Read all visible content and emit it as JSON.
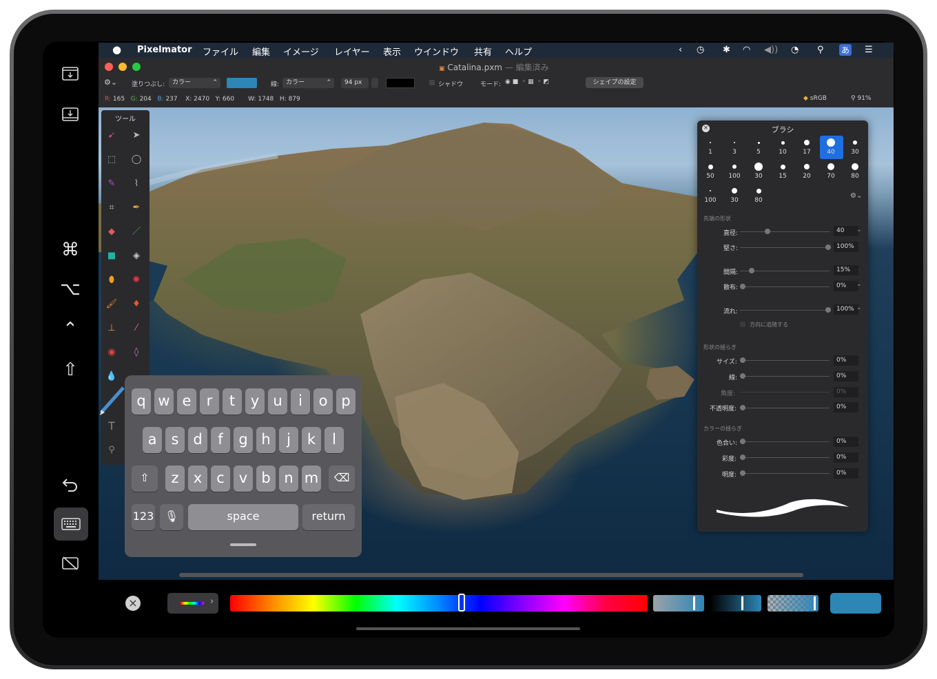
{
  "menubar": {
    "app": "Pixelmator",
    "items": [
      "ファイル",
      "編集",
      "イメージ",
      "レイヤー",
      "表示",
      "ウインドウ",
      "共有",
      "ヘルプ"
    ],
    "ime": "あ"
  },
  "window": {
    "title": "Catalina.pxm",
    "status": "編集済み"
  },
  "toolbar": {
    "fill_label": "塗りつぶし:",
    "fill_value": "カラー",
    "fill_color": "#2d86b6",
    "stroke_label": "線:",
    "stroke_value": "カラー",
    "stroke_width": "94 px",
    "stroke_color": "#000000",
    "shadow_label": "シャドウ",
    "mode_label": "モード:",
    "shape_settings_button": "シェイプの設定"
  },
  "infobar": {
    "r_label": "R:",
    "r": "165",
    "g_label": "G:",
    "g": "204",
    "b_label": "B:",
    "b": "237",
    "x_label": "X:",
    "x": "2470",
    "y_label": "Y:",
    "y": "660",
    "w_label": "W:",
    "w": "1748",
    "h_label": "H:",
    "h": "879",
    "color_profile": "sRGB",
    "zoom": "91%"
  },
  "tools_panel": {
    "title": "ツール"
  },
  "brushes_panel": {
    "title": "ブラシ",
    "presets_row1": [
      "1",
      "3",
      "5",
      "10",
      "17",
      "40",
      "30"
    ],
    "presets_row2": [
      "50",
      "100",
      "30",
      "15",
      "20",
      "70",
      "80"
    ],
    "presets_row3": [
      "100",
      "30",
      "80"
    ],
    "selected_preset": "40",
    "tip_section": "先端の形状",
    "diameter_label": "直径:",
    "diameter": "40",
    "hardness_label": "堅さ:",
    "hardness": "100%",
    "spacing_label": "間隔:",
    "spacing": "15%",
    "scatter_label": "散布:",
    "scatter": "0%",
    "flow_label": "流れ:",
    "flow": "100%",
    "follow_direction": "方向に追随する",
    "shape_jitter_section": "形状の揺らぎ",
    "size_label": "サイズ:",
    "size": "0%",
    "thin_label": "線:",
    "thin": "0%",
    "angle_label": "角度:",
    "angle": "0%",
    "opacity_label": "不透明度:",
    "opacity": "0%",
    "color_jitter_section": "カラーの揺らぎ",
    "hue_label": "色合い:",
    "hue": "0%",
    "saturation_label": "彩度:",
    "saturation": "0%",
    "brightness_label": "明度:",
    "brightness": "0%"
  },
  "keyboard": {
    "row1": [
      "q",
      "w",
      "e",
      "r",
      "t",
      "y",
      "u",
      "i",
      "o",
      "p"
    ],
    "row2": [
      "a",
      "s",
      "d",
      "f",
      "g",
      "h",
      "j",
      "k",
      "l"
    ],
    "row3": [
      "z",
      "x",
      "c",
      "v",
      "b",
      "n",
      "m"
    ],
    "numbers_key": "123",
    "space_key": "space",
    "return_key": "return"
  },
  "colors": {
    "accent": "#2d86b6",
    "spectrum_position": 0.555
  }
}
